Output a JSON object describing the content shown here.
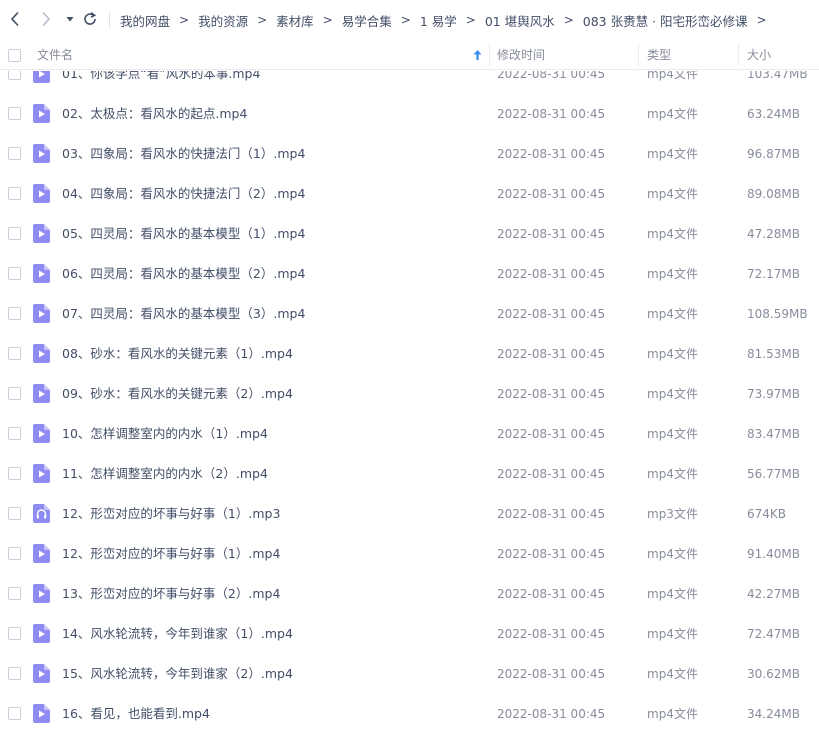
{
  "nav": {
    "back_icon": "chevron-left-icon",
    "forward_icon": "chevron-right-icon",
    "history_icon": "caret-down-icon",
    "refresh_icon": "refresh-icon"
  },
  "breadcrumb": [
    "我的网盘",
    "我的资源",
    "素材库",
    "易学合集",
    "1 易学",
    "01 堪舆风水",
    "083 张赉慧 · 阳宅形峦必修课"
  ],
  "breadcrumb_separator": ">",
  "columns": {
    "name": "文件名",
    "time": "修改时间",
    "type": "类型",
    "size": "大小"
  },
  "colors": {
    "video_icon": "#8e8cf3",
    "audio_icon": "#8e8cf3",
    "sort_arrow": "#3a8cf5",
    "text": "#424e67",
    "muted": "#878c9c"
  },
  "files": [
    {
      "name": "01、你该学点“看”风水的本事.mp4",
      "time": "2022-08-31 00:45",
      "type": "mp4文件",
      "size": "103.47MB",
      "icon": "video-file-icon"
    },
    {
      "name": "02、太极点：看风水的起点.mp4",
      "time": "2022-08-31 00:45",
      "type": "mp4文件",
      "size": "63.24MB",
      "icon": "video-file-icon"
    },
    {
      "name": "03、四象局：看风水的快捷法门（1）.mp4",
      "time": "2022-08-31 00:45",
      "type": "mp4文件",
      "size": "96.87MB",
      "icon": "video-file-icon"
    },
    {
      "name": "04、四象局：看风水的快捷法门（2）.mp4",
      "time": "2022-08-31 00:45",
      "type": "mp4文件",
      "size": "89.08MB",
      "icon": "video-file-icon"
    },
    {
      "name": "05、四灵局：看风水的基本模型（1）.mp4",
      "time": "2022-08-31 00:45",
      "type": "mp4文件",
      "size": "47.28MB",
      "icon": "video-file-icon"
    },
    {
      "name": "06、四灵局：看风水的基本模型（2）.mp4",
      "time": "2022-08-31 00:45",
      "type": "mp4文件",
      "size": "72.17MB",
      "icon": "video-file-icon"
    },
    {
      "name": "07、四灵局：看风水的基本模型（3）.mp4",
      "time": "2022-08-31 00:45",
      "type": "mp4文件",
      "size": "108.59MB",
      "icon": "video-file-icon"
    },
    {
      "name": "08、砂水：看风水的关键元素（1）.mp4",
      "time": "2022-08-31 00:45",
      "type": "mp4文件",
      "size": "81.53MB",
      "icon": "video-file-icon"
    },
    {
      "name": "09、砂水：看风水的关键元素（2）.mp4",
      "time": "2022-08-31 00:45",
      "type": "mp4文件",
      "size": "73.97MB",
      "icon": "video-file-icon"
    },
    {
      "name": "10、怎样调整室内的内水（1）.mp4",
      "time": "2022-08-31 00:45",
      "type": "mp4文件",
      "size": "83.47MB",
      "icon": "video-file-icon"
    },
    {
      "name": "11、怎样调整室内的内水（2）.mp4",
      "time": "2022-08-31 00:45",
      "type": "mp4文件",
      "size": "56.77MB",
      "icon": "video-file-icon"
    },
    {
      "name": "12、形峦对应的坏事与好事（1）.mp3",
      "time": "2022-08-31 00:45",
      "type": "mp3文件",
      "size": "674KB",
      "icon": "audio-file-icon"
    },
    {
      "name": "12、形峦对应的坏事与好事（1）.mp4",
      "time": "2022-08-31 00:45",
      "type": "mp4文件",
      "size": "91.40MB",
      "icon": "video-file-icon"
    },
    {
      "name": "13、形峦对应的坏事与好事（2）.mp4",
      "time": "2022-08-31 00:45",
      "type": "mp4文件",
      "size": "42.27MB",
      "icon": "video-file-icon"
    },
    {
      "name": "14、风水轮流转，今年到谁家（1）.mp4",
      "time": "2022-08-31 00:45",
      "type": "mp4文件",
      "size": "72.47MB",
      "icon": "video-file-icon"
    },
    {
      "name": "15、风水轮流转，今年到谁家（2）.mp4",
      "time": "2022-08-31 00:45",
      "type": "mp4文件",
      "size": "30.62MB",
      "icon": "video-file-icon"
    },
    {
      "name": "16、看见，也能看到.mp4",
      "time": "2022-08-31 00:45",
      "type": "mp4文件",
      "size": "34.24MB",
      "icon": "video-file-icon"
    }
  ]
}
